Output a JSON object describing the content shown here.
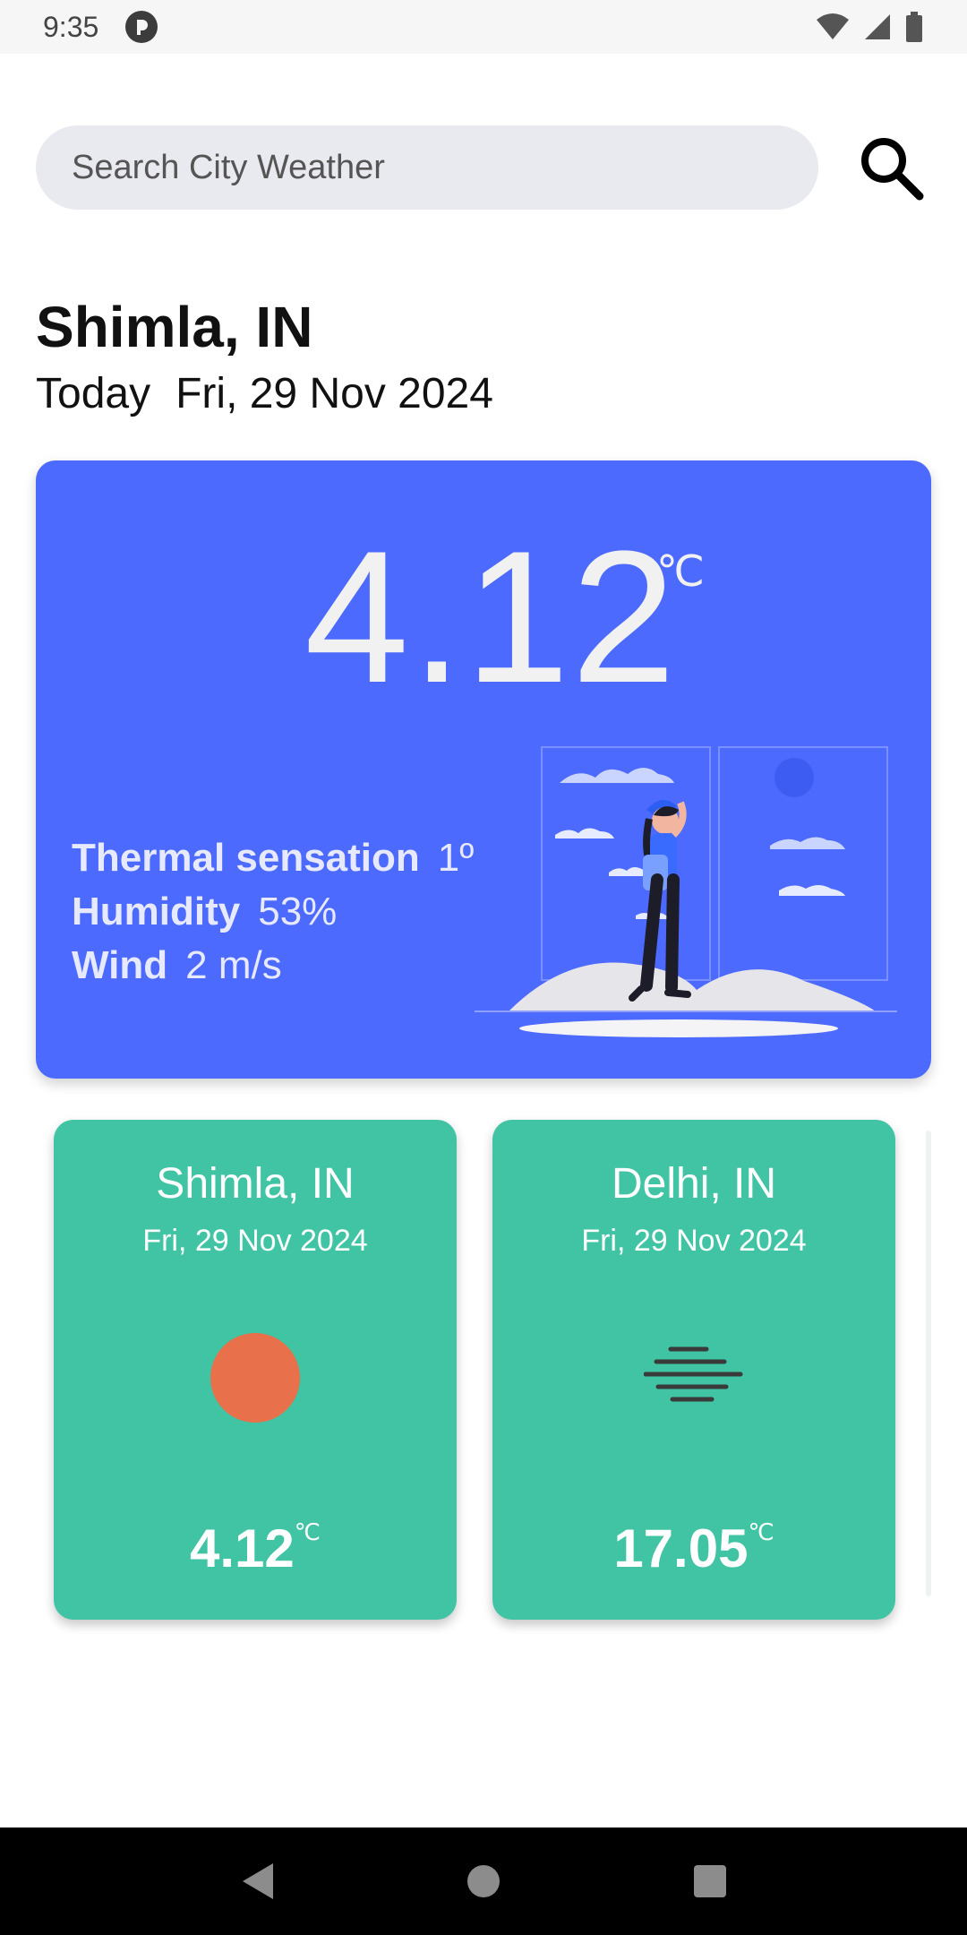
{
  "status_bar": {
    "time": "9:35",
    "icons": [
      "app-notification-icon",
      "wifi-icon",
      "signal-icon",
      "battery-icon"
    ]
  },
  "search": {
    "placeholder": "Search City Weather",
    "value": "",
    "button_icon": "search-icon"
  },
  "location": {
    "city": "Shimla, IN",
    "today_label": "Today",
    "date": "Fri, 29 Nov 2024"
  },
  "current_weather": {
    "temperature": "4.12",
    "unit": "℃",
    "thermal_label": "Thermal sensation",
    "thermal_value": "1º",
    "humidity_label": "Humidity",
    "humidity_value": "53%",
    "wind_label": "Wind",
    "wind_value": "2 m/s",
    "card_color": "#4d6afe",
    "illustration": "traveler-illustration"
  },
  "city_cards": [
    {
      "city": "Shimla, IN",
      "date": "Fri, 29 Nov 2024",
      "icon": "sun-icon",
      "temperature": "4.12",
      "unit": "℃"
    },
    {
      "city": "Delhi, IN",
      "date": "Fri, 29 Nov 2024",
      "icon": "haze-icon",
      "temperature": "17.05",
      "unit": "℃"
    }
  ],
  "colors": {
    "accent": "#4d6afe",
    "card": "#40c4a4",
    "sun": "#e8704a",
    "haze": "#3a3a3a"
  },
  "nav": {
    "icons": [
      "back-icon",
      "home-icon",
      "recents-icon"
    ]
  }
}
